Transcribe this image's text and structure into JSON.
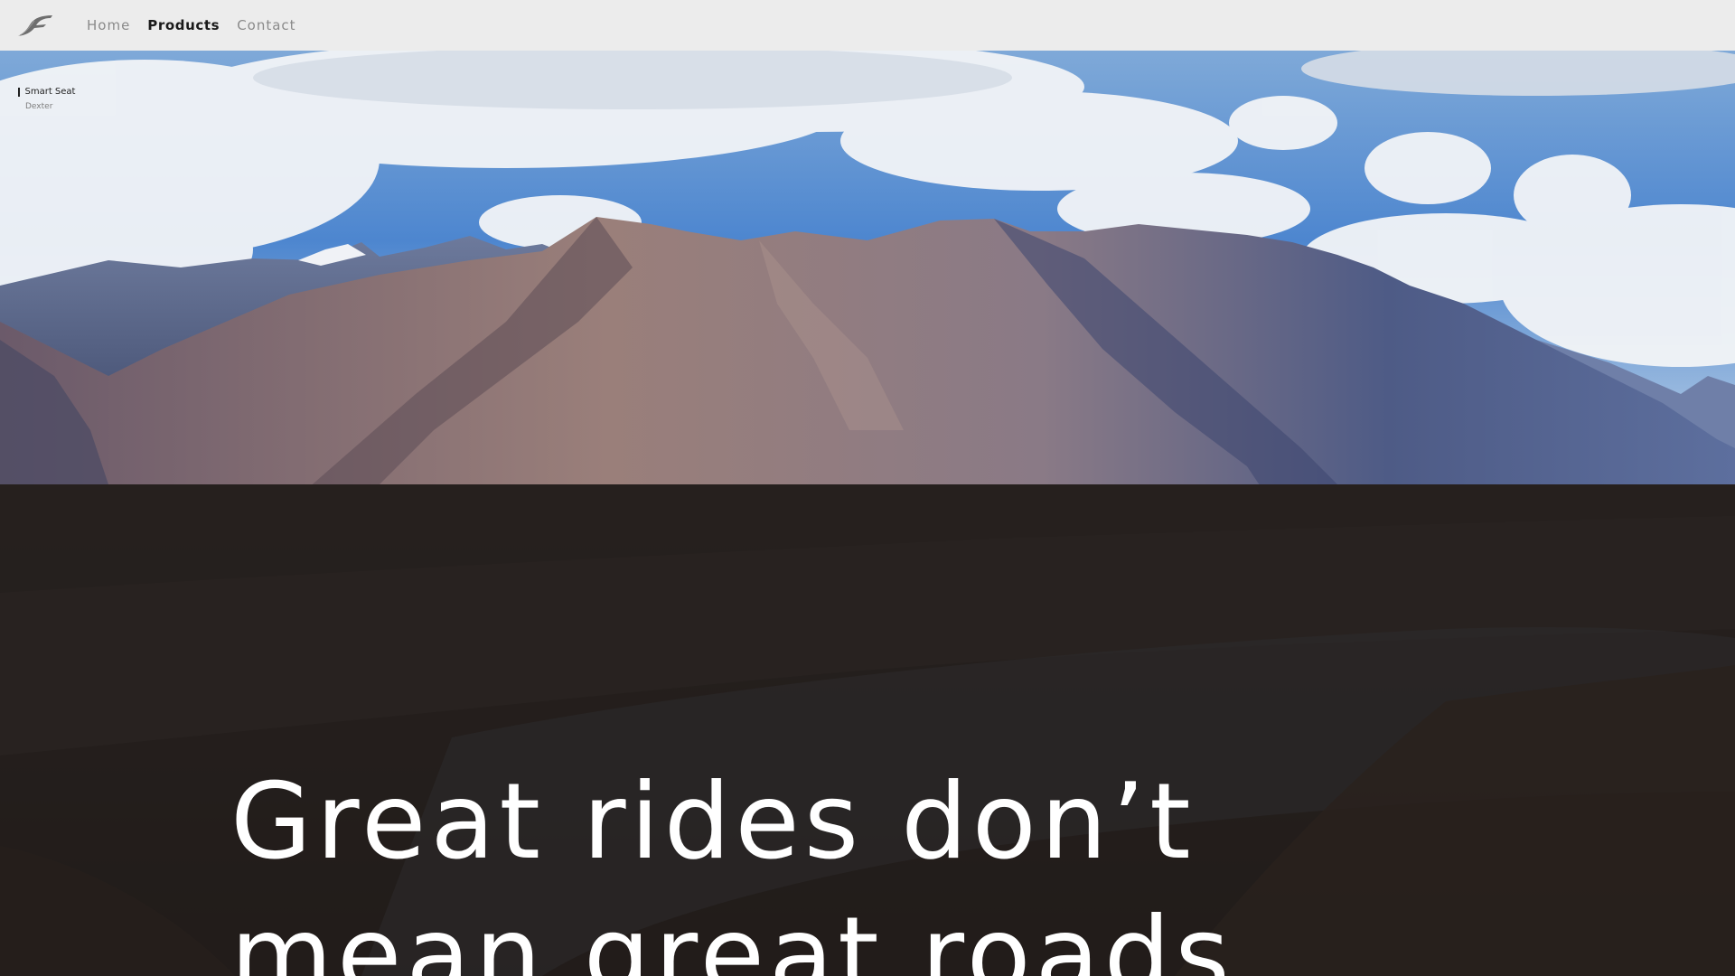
{
  "nav": {
    "logo_icon": "feather-logo-icon",
    "items": [
      {
        "label": "Home",
        "active": false
      },
      {
        "label": "Products",
        "active": true
      },
      {
        "label": "Contact",
        "active": false
      }
    ]
  },
  "breadcrumb": {
    "current": "Smart Seat",
    "sub": "Dexter"
  },
  "hero": {
    "headline": "Great rides don’t mean great roads"
  },
  "colors": {
    "navbar_bg": "#ececec",
    "nav_active": "#1a1a1a",
    "nav_inactive": "#8a8a8a",
    "overlay": "#12100f",
    "headline": "#ffffff"
  }
}
